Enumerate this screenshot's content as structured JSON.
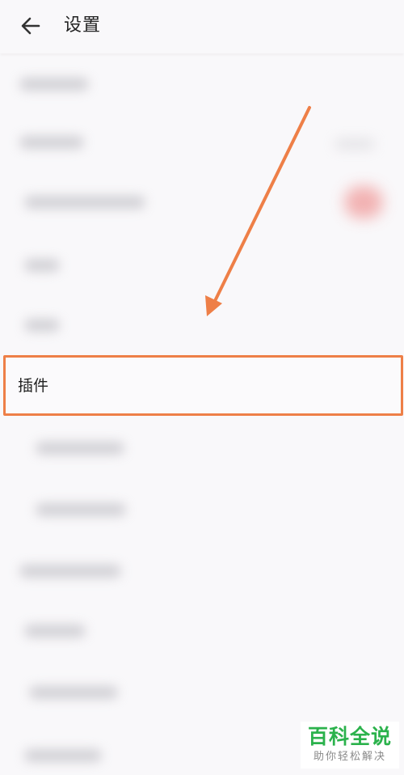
{
  "header": {
    "title": "设置",
    "back_icon": "arrow-left-icon"
  },
  "highlighted_item": {
    "label": "插件"
  },
  "annotation": {
    "arrow_color": "#ee7f47",
    "highlight_color": "#ee7f47"
  },
  "watermark": {
    "main": "百科全说",
    "sub": "助你轻松解决"
  },
  "colors": {
    "background": "#f9f8fa",
    "toggle_blur": "#f1a6a6",
    "watermark_green": "#2bb24c"
  }
}
